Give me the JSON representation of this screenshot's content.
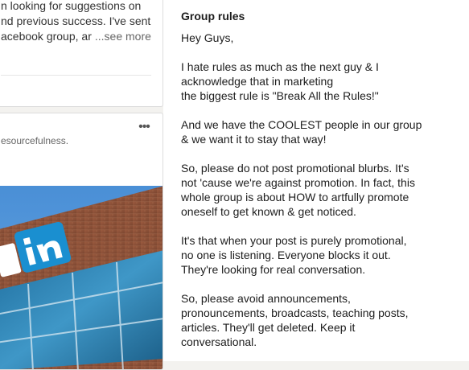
{
  "left_feed": {
    "post_1": {
      "lines": [
        "n looking for suggestions on",
        "nd previous success. I've sent",
        "acebook group, ar"
      ],
      "see_more": "...see more"
    },
    "post_2": {
      "more_icon": "ellipsis-icon",
      "more_glyph": "•••",
      "snippet": "esourcefulness.",
      "image_logo_text": "d in",
      "image_subject": "LinkedIn building facade with logo sign"
    }
  },
  "group_rules": {
    "title": "Group rules",
    "paragraphs": [
      [
        "Hey Guys,"
      ],
      [
        "I hate rules as much as the next guy & I",
        "acknowledge that in marketing",
        "the biggest rule is \"Break All the Rules!\""
      ],
      [
        "And we have the COOLEST people in our group",
        "& we want it to stay that way!"
      ],
      [
        "So, please do not post promotional blurbs. It's",
        "not 'cause we're against promotion. In fact, this",
        "whole group is about HOW to artfully promote",
        "oneself to get known & get noticed."
      ],
      [
        "It's that when your post is purely promotional,",
        "no one is listening. Everyone blocks it out.",
        "They're looking for real conversation."
      ],
      [
        "So, please avoid announcements,",
        "pronouncements, broadcasts, teaching posts,",
        "articles. They'll get deleted. Keep it",
        "conversational."
      ]
    ]
  },
  "colors": {
    "background": "#f3f2ef",
    "card": "#ffffff",
    "linkedin_blue": "#1a8fd0"
  }
}
